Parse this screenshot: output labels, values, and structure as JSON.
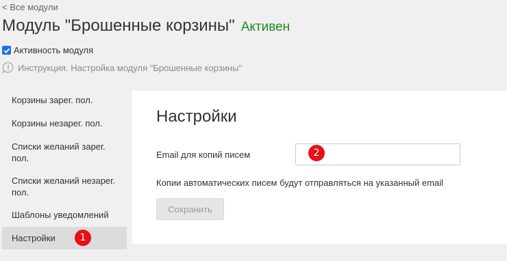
{
  "back_link": "< Все модули",
  "header": {
    "title": "Модуль \"Брошенные корзины\"",
    "status": "Активен",
    "status_color": "#1f8a1f"
  },
  "activity": {
    "label": "Активность модуля",
    "checked": true
  },
  "instruction": {
    "icon": "info-bubble-icon",
    "text": "Инструкция. Настройка модуля \"Брошенные корзины\""
  },
  "sidebar": {
    "items": [
      {
        "label": "Корзины зарег. пол."
      },
      {
        "label": "Корзины незарег. пол."
      },
      {
        "label": "Списки желаний зарег. пол."
      },
      {
        "label": "Списки желаний незарег. пол."
      },
      {
        "label": "Шаблоны уведомлений"
      },
      {
        "label": "Настройки",
        "active": true
      }
    ]
  },
  "markers": {
    "first": "1",
    "second": "2",
    "color": "#e8101a"
  },
  "settings": {
    "title": "Настройки",
    "email_label": "Email для копий писем",
    "email_value": "",
    "hint": "Копии автоматических писем будут отправляться на указанный email",
    "save_label": "Сохранить"
  }
}
